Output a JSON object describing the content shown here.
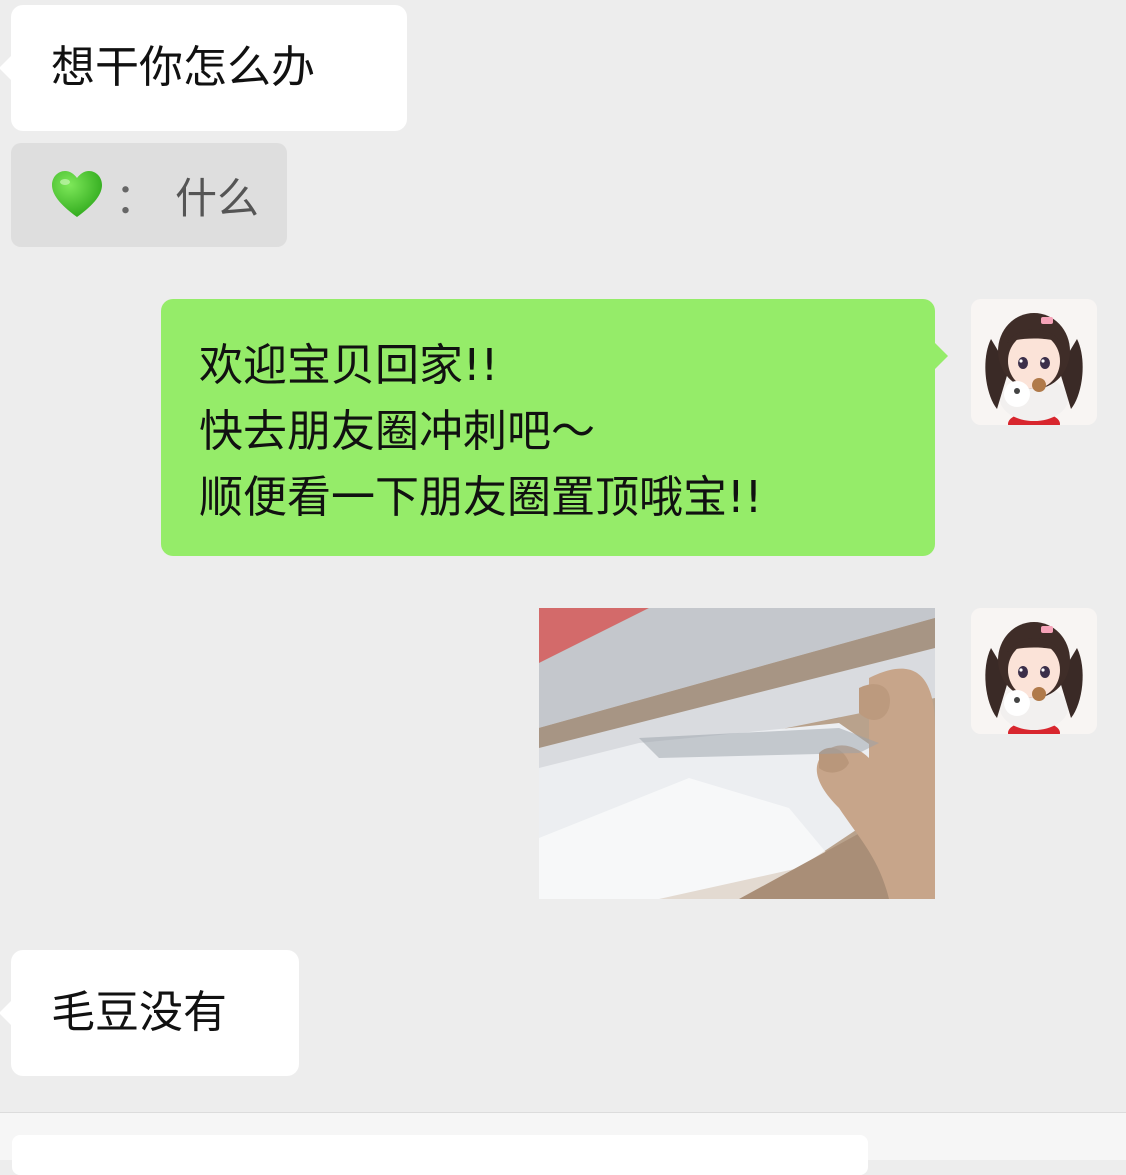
{
  "messages": [
    {
      "side": "in",
      "text": "想干你怎么办"
    },
    {
      "side": "quote",
      "icon": "green-heart-icon",
      "separator": "：",
      "text": "什么"
    },
    {
      "side": "out",
      "lines": [
        "欢迎宝贝回家!!",
        "快去朋友圈冲刺吧～",
        "顺便看一下朋友圈置顶哦宝!!"
      ]
    },
    {
      "side": "out",
      "type": "image",
      "image": "anime-hand-pulling-cloth-image"
    },
    {
      "side": "in",
      "text": "毛豆没有"
    }
  ],
  "colors": {
    "background": "#ededed",
    "incoming_bubble": "#ffffff",
    "outgoing_bubble": "#95ec69",
    "quote_block": "#dedede"
  },
  "input": {
    "value": ""
  }
}
